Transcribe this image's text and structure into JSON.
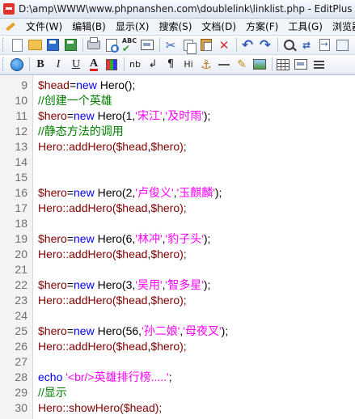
{
  "window": {
    "title": "D:\\amp\\WWW\\www.phpnanshen.com\\doublelink\\linklist.php - EditPlus"
  },
  "menu": [
    "文件(W)",
    "编辑(B)",
    "显示(X)",
    "搜索(S)",
    "文档(D)",
    "方案(F)",
    "工具(G)",
    "浏览器"
  ],
  "toolbar1": [
    {
      "icon": "new-file-icon"
    },
    {
      "icon": "open-folder-icon"
    },
    {
      "icon": "save-icon"
    },
    {
      "icon": "save-all-icon"
    },
    {
      "icon": "print-icon"
    },
    {
      "icon": "print-preview-icon"
    },
    {
      "icon": "spell-check-icon"
    },
    {
      "icon": "browser-preview-icon"
    },
    {
      "icon": "cut-icon"
    },
    {
      "icon": "copy-icon"
    },
    {
      "icon": "paste-icon"
    },
    {
      "icon": "delete-icon"
    },
    {
      "icon": "undo-icon"
    },
    {
      "icon": "redo-icon"
    },
    {
      "icon": "find-icon"
    },
    {
      "icon": "replace-icon"
    },
    {
      "icon": "goto-icon"
    },
    {
      "icon": "word-wrap-icon"
    }
  ],
  "toolbar2": {
    "bold": "B",
    "italic": "I",
    "underline": "U",
    "color": "A",
    "nbsp": "nb",
    "break": "↲",
    "paragraph": "¶",
    "heading": "Hi"
  },
  "editor": {
    "lines": [
      {
        "num": "9",
        "tokens": [
          [
            "var",
            "$head"
          ],
          [
            "plain",
            "="
          ],
          [
            "kw",
            "new"
          ],
          [
            "plain",
            " Hero();"
          ]
        ]
      },
      {
        "num": "10",
        "tokens": [
          [
            "comment",
            "//创建一个英雄"
          ]
        ]
      },
      {
        "num": "11",
        "tokens": [
          [
            "var",
            "$hero"
          ],
          [
            "plain",
            "="
          ],
          [
            "kw",
            "new"
          ],
          [
            "plain",
            " Hero(1,"
          ],
          [
            "str",
            "'宋江'"
          ],
          [
            "plain",
            ","
          ],
          [
            "str",
            "'及时雨'"
          ],
          [
            "plain",
            ");"
          ]
        ]
      },
      {
        "num": "12",
        "tokens": [
          [
            "comment",
            "//静态方法的调用"
          ]
        ]
      },
      {
        "num": "13",
        "tokens": [
          [
            "func",
            "Hero::addHero("
          ],
          [
            "var",
            "$head"
          ],
          [
            "plain",
            ","
          ],
          [
            "var",
            "$hero"
          ],
          [
            "func",
            ");"
          ]
        ]
      },
      {
        "num": "14",
        "tokens": []
      },
      {
        "num": "15",
        "tokens": []
      },
      {
        "num": "16",
        "tokens": [
          [
            "var",
            "$hero"
          ],
          [
            "plain",
            "="
          ],
          [
            "kw",
            "new"
          ],
          [
            "plain",
            " Hero(2,"
          ],
          [
            "str",
            "'卢俊义'"
          ],
          [
            "plain",
            ","
          ],
          [
            "str",
            "'玉麒麟'"
          ],
          [
            "plain",
            ");"
          ]
        ]
      },
      {
        "num": "17",
        "tokens": [
          [
            "func",
            "Hero::addHero("
          ],
          [
            "var",
            "$head"
          ],
          [
            "plain",
            ","
          ],
          [
            "var",
            "$hero"
          ],
          [
            "func",
            ");"
          ]
        ]
      },
      {
        "num": "18",
        "tokens": []
      },
      {
        "num": "19",
        "tokens": [
          [
            "var",
            "$hero"
          ],
          [
            "plain",
            "="
          ],
          [
            "kw",
            "new"
          ],
          [
            "plain",
            " Hero(6,"
          ],
          [
            "str",
            "'林冲'"
          ],
          [
            "plain",
            ","
          ],
          [
            "str",
            "'豹子头'"
          ],
          [
            "plain",
            ");"
          ]
        ]
      },
      {
        "num": "20",
        "tokens": [
          [
            "func",
            "Hero::addHero("
          ],
          [
            "var",
            "$head"
          ],
          [
            "plain",
            ","
          ],
          [
            "var",
            "$hero"
          ],
          [
            "func",
            ");"
          ]
        ]
      },
      {
        "num": "21",
        "tokens": []
      },
      {
        "num": "22",
        "tokens": [
          [
            "var",
            "$hero"
          ],
          [
            "plain",
            "="
          ],
          [
            "kw",
            "new"
          ],
          [
            "plain",
            " Hero(3,"
          ],
          [
            "str",
            "'吴用'"
          ],
          [
            "plain",
            ","
          ],
          [
            "str",
            "'智多星'"
          ],
          [
            "plain",
            ");"
          ]
        ]
      },
      {
        "num": "23",
        "tokens": [
          [
            "func",
            "Hero::addHero("
          ],
          [
            "var",
            "$head"
          ],
          [
            "plain",
            ","
          ],
          [
            "var",
            "$hero"
          ],
          [
            "func",
            ");"
          ]
        ]
      },
      {
        "num": "24",
        "tokens": []
      },
      {
        "num": "25",
        "tokens": [
          [
            "var",
            "$hero"
          ],
          [
            "plain",
            "="
          ],
          [
            "kw",
            "new"
          ],
          [
            "plain",
            " Hero(56,"
          ],
          [
            "str",
            "'孙二娘'"
          ],
          [
            "plain",
            ","
          ],
          [
            "str",
            "'母夜叉'"
          ],
          [
            "plain",
            ");"
          ]
        ]
      },
      {
        "num": "26",
        "tokens": [
          [
            "func",
            "Hero::addHero("
          ],
          [
            "var",
            "$head"
          ],
          [
            "plain",
            ","
          ],
          [
            "var",
            "$hero"
          ],
          [
            "func",
            ");"
          ]
        ]
      },
      {
        "num": "27",
        "tokens": []
      },
      {
        "num": "28",
        "tokens": [
          [
            "kw",
            "echo"
          ],
          [
            "plain",
            " "
          ],
          [
            "str",
            "'<br/>英雄排行榜.....'"
          ],
          [
            "plain",
            ";"
          ]
        ]
      },
      {
        "num": "29",
        "tokens": [
          [
            "comment",
            "//显示"
          ]
        ]
      },
      {
        "num": "30",
        "tokens": [
          [
            "func",
            "Hero::showHero("
          ],
          [
            "var",
            "$head"
          ],
          [
            "func",
            ");"
          ]
        ]
      }
    ]
  }
}
